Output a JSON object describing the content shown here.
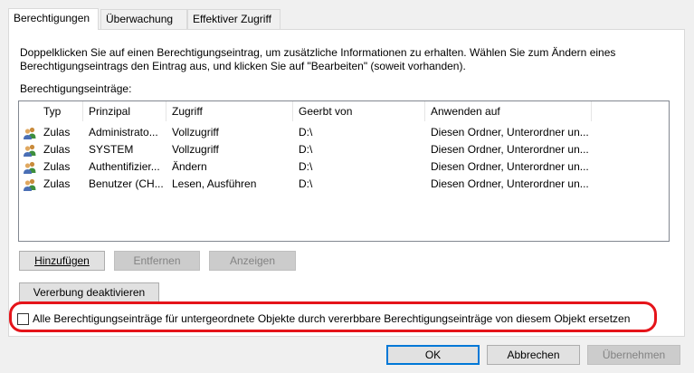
{
  "tabs": [
    {
      "label": "Berechtigungen"
    },
    {
      "label": "Überwachung"
    },
    {
      "label": "Effektiver Zugriff"
    }
  ],
  "description": {
    "line1": "Doppelklicken Sie auf einen Berechtigungseintrag, um zusätzliche Informationen zu erhalten. Wählen Sie zum Ändern eines",
    "line2": "Berechtigungseintrags den Eintrag aus, und klicken Sie auf \"Bearbeiten\" (soweit vorhanden)."
  },
  "entries_label": "Berechtigungseinträge:",
  "columns": [
    "Typ",
    "Prinzipal",
    "Zugriff",
    "Geerbt von",
    "Anwenden auf"
  ],
  "rows": [
    {
      "icon": "user-group-icon",
      "typ": "Zulas",
      "prinzipal": "Administrato...",
      "zugriff": "Vollzugriff",
      "geerbt": "D:\\",
      "anwenden": "Diesen Ordner, Unterordner un..."
    },
    {
      "icon": "user-group-icon",
      "typ": "Zulas",
      "prinzipal": "SYSTEM",
      "zugriff": "Vollzugriff",
      "geerbt": "D:\\",
      "anwenden": "Diesen Ordner, Unterordner un..."
    },
    {
      "icon": "user-group-icon",
      "typ": "Zulas",
      "prinzipal": "Authentifizier...",
      "zugriff": "Ändern",
      "geerbt": "D:\\",
      "anwenden": "Diesen Ordner, Unterordner un..."
    },
    {
      "icon": "user-group-icon",
      "typ": "Zulas",
      "prinzipal": "Benutzer (CH...",
      "zugriff": "Lesen, Ausführen",
      "geerbt": "D:\\",
      "anwenden": "Diesen Ordner, Unterordner un..."
    }
  ],
  "buttons": {
    "add": "Hinzufügen",
    "remove": "Entfernen",
    "view": "Anzeigen",
    "inheritance": "Vererbung deaktivieren",
    "ok": "OK",
    "cancel": "Abbrechen",
    "apply": "Übernehmen"
  },
  "replace_checkbox": {
    "label": "Alle Berechtigungseinträge für untergeordnete Objekte durch vererbbare Berechtigungseinträge von diesem Objekt ersetzen",
    "checked": false
  },
  "colors": {
    "annotation": "#e5141a",
    "default_button_border": "#0078d7"
  }
}
